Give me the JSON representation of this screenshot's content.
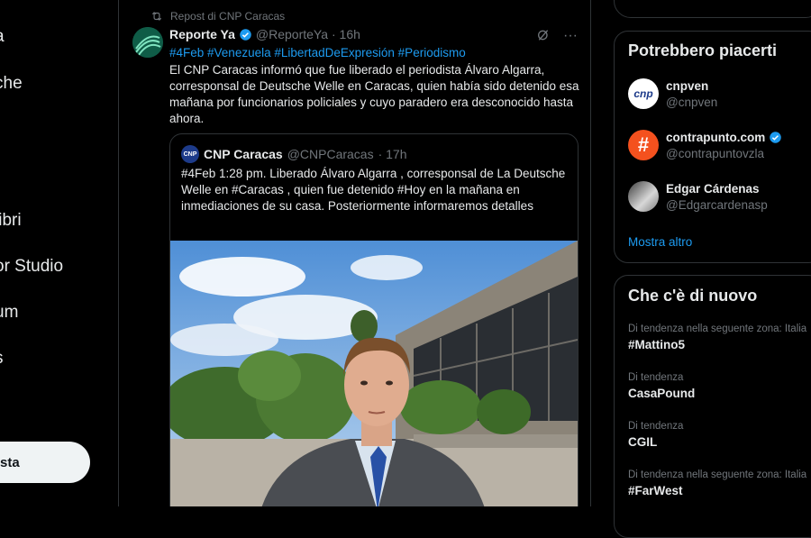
{
  "left_nav": {
    "items": [
      "a",
      "che",
      "libri",
      "or Studio",
      "um",
      "s"
    ],
    "post_label": "sta"
  },
  "repost": {
    "label": "Repost di CNP Caracas"
  },
  "tweet": {
    "name": "Reporte Ya",
    "handle": "@ReporteYa",
    "time": "· 16h",
    "hashtags": "#4Feb #Venezuela #LibertadDeExpresión #Periodismo",
    "text": "El CNP Caracas informó que fue liberado el periodista Álvaro Algarra, corresponsal de Deutsche Welle en Caracas, quien había sido detenido esa mañana por funcionarios policiales y cuyo paradero era desconocido hasta ahora.",
    "more_label": "···"
  },
  "quote": {
    "avatar_text": "CNP",
    "name": "CNP Caracas",
    "handle": "@CNPCaracas",
    "time": "· 17h",
    "text": "#4Feb 1:28 pm.   Liberado Álvaro Algarra ,  corresponsal de La Deutsche Welle en #Caracas , quien fue detenido #Hoy en la mañana en inmediaciones de su casa.  Posteriormente informaremos detalles"
  },
  "suggestions": {
    "title": "Potrebbero piacerti",
    "accounts": [
      {
        "name": "cnpven",
        "handle": "@cnpven",
        "verified": false,
        "avatar_text": "cnp"
      },
      {
        "name": "contrapunto.com",
        "handle": "@contrapuntovzla",
        "verified": true,
        "avatar_text": "#"
      },
      {
        "name": "Edgar Cárdenas",
        "handle": "@Edgarcardenasp",
        "verified": false,
        "avatar_text": ""
      }
    ],
    "show_more": "Mostra altro"
  },
  "trends": {
    "title": "Che c'è di nuovo",
    "items": [
      {
        "context": "Di tendenza nella seguente zona: Italia",
        "topic": "#Mattino5"
      },
      {
        "context": "Di tendenza",
        "topic": "CasaPound"
      },
      {
        "context": "Di tendenza",
        "topic": "CGIL"
      },
      {
        "context": "Di tendenza nella seguente zona: Italia",
        "topic": "#FarWest"
      }
    ]
  },
  "colors": {
    "background": "#000000",
    "accent": "#1d9bf0",
    "border": "#2f3336",
    "muted": "#71767b",
    "contrapunto": "#f4511e"
  }
}
